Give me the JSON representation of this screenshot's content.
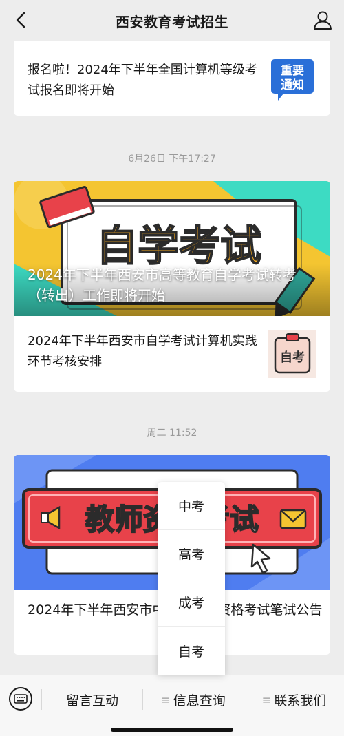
{
  "header": {
    "title": "西安教育考试招生"
  },
  "feed": {
    "top_item": {
      "title": "报名啦！2024年下半年全国计算机等级考试报名即将开始",
      "thumb_text": [
        "重要",
        "通知"
      ]
    },
    "group1": {
      "time": "6月26日 下午17:27",
      "banner_text": "自学考试",
      "hero_title": "2024年下半年西安市高等教育自学考试转考（转出）工作即将开始",
      "item": {
        "title": "2024年下半年西安市自学考试计算机实践环节考核安排",
        "thumb_text": "自考"
      }
    },
    "group2": {
      "time": "周二 11:52",
      "banner_text": "教师资格考试",
      "hero_title": "2024年下半年西安市中小学教师资格考试笔试公告"
    }
  },
  "bottom_menu": {
    "items": [
      {
        "label": "留言互动"
      },
      {
        "label": "信息查询"
      },
      {
        "label": "联系我们"
      }
    ],
    "menu_glyph": "≡"
  },
  "popup": {
    "items": [
      "中考",
      "高考",
      "成考",
      "自考"
    ]
  },
  "colors": {
    "page_bg": "#ededed",
    "card_bg": "#ffffff",
    "time_text": "#9a9a9a",
    "banner_yellow": "#f4c531",
    "banner_teal": "#3ddbc3",
    "banner_blue": "#4f7df0",
    "banner_red": "#e8424a"
  }
}
